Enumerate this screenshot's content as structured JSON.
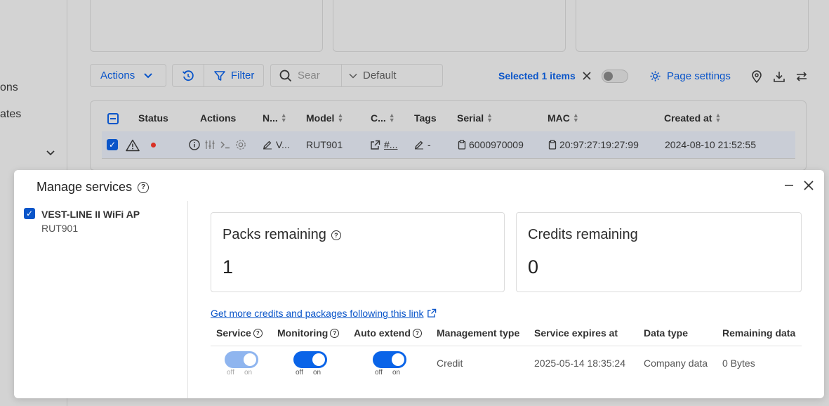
{
  "sidebar": {
    "item1": "ons",
    "item2": "ates"
  },
  "toolbar": {
    "actions_label": "Actions",
    "filter_label": "Filter",
    "search_placeholder": "Sear",
    "view_label": "Default",
    "selected_text": "Selected 1 items",
    "page_settings_label": "Page settings"
  },
  "table": {
    "headers": [
      "Status",
      "Actions",
      "N...",
      "Model",
      "C...",
      "Tags",
      "Serial",
      "MAC",
      "Created at"
    ],
    "row": {
      "status_color": "#d93025",
      "name": "V...",
      "model": "RUT901",
      "company": "#...",
      "tags": "-",
      "serial": "6000970009",
      "mac": "20:97:27:19:27:99",
      "created_at": "2024-08-10 21:52:55"
    }
  },
  "modal": {
    "title": "Manage services",
    "device": {
      "name": "VEST-LINE II WiFi AP",
      "model": "RUT901"
    },
    "packs": {
      "title": "Packs remaining",
      "value": "1"
    },
    "credits": {
      "title": "Credits remaining",
      "value": "0"
    },
    "link_text": "Get more credits and packages following this link",
    "columns": [
      "Service",
      "Monitoring",
      "Auto extend",
      "Management type",
      "Service expires at",
      "Data type",
      "Remaining data"
    ],
    "service_row": {
      "service_on": true,
      "service_disabled": true,
      "monitoring_on": true,
      "auto_extend_on": true,
      "toggle_off_label": "off",
      "toggle_on_label": "on",
      "management_type": "Credit",
      "expires": "2025-05-14 18:35:24",
      "data_type": "Company data",
      "remaining": "0 Bytes"
    }
  },
  "colors": {
    "accent": "#0a64e8",
    "link": "#0a55c9",
    "status_dot": "#d93025"
  }
}
